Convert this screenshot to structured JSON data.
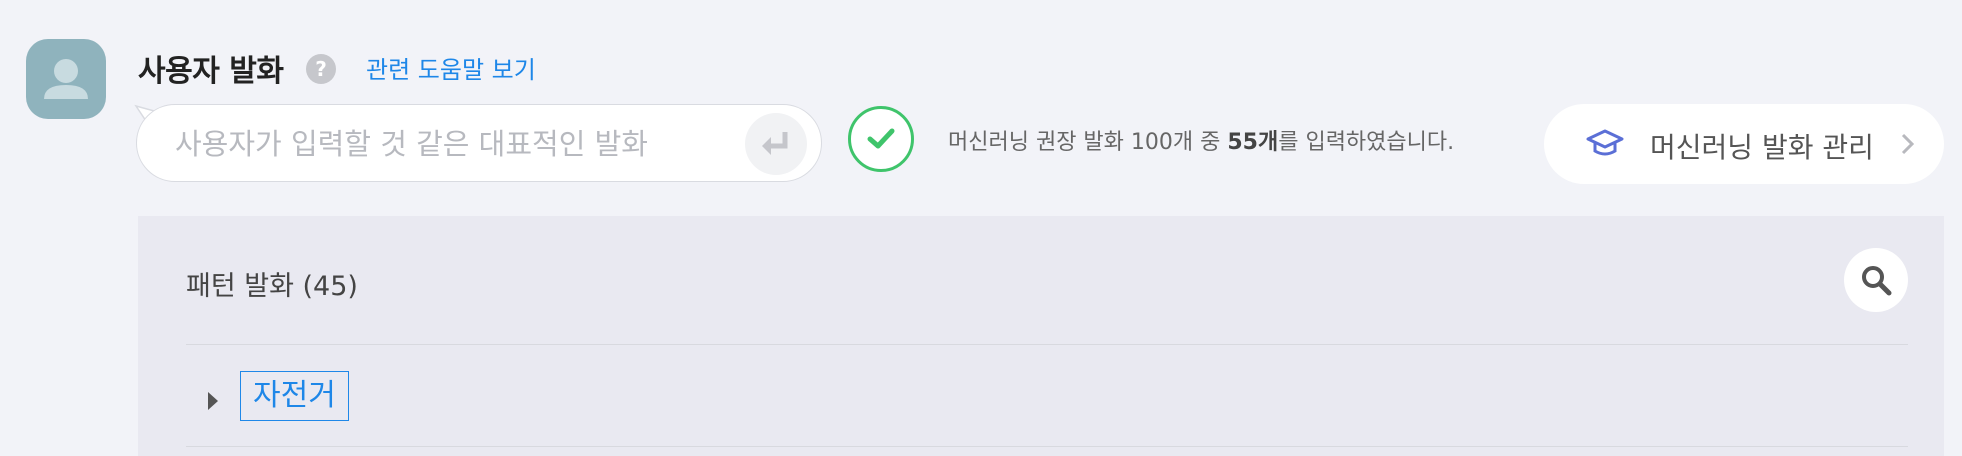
{
  "header": {
    "title": "사용자 발화",
    "help_icon": "question-icon",
    "help_link": "관련 도움말 보기"
  },
  "input": {
    "placeholder": "사용자가 입력할 것 같은 대표적인 발화",
    "value": "",
    "submit_icon": "enter-icon"
  },
  "ml_status": {
    "icon": "check-icon",
    "prefix": "머신러닝 권장 발화 100개 중 ",
    "count": "55개",
    "suffix": "를 입력하였습니다."
  },
  "ml_button": {
    "icon": "graduation-cap-icon",
    "label": "머신러닝 발화 관리",
    "chevron": "chevron-right-icon"
  },
  "pattern_panel": {
    "title": "패턴 발화 (45)",
    "search_icon": "search-icon",
    "items": [
      {
        "label": "자전거",
        "expanded": false
      }
    ]
  },
  "colors": {
    "background": "#f2f3f8",
    "link": "#1e87e8",
    "success": "#3fc46b",
    "avatar": "#8fb3bd",
    "panel": "#e9e9f1"
  }
}
